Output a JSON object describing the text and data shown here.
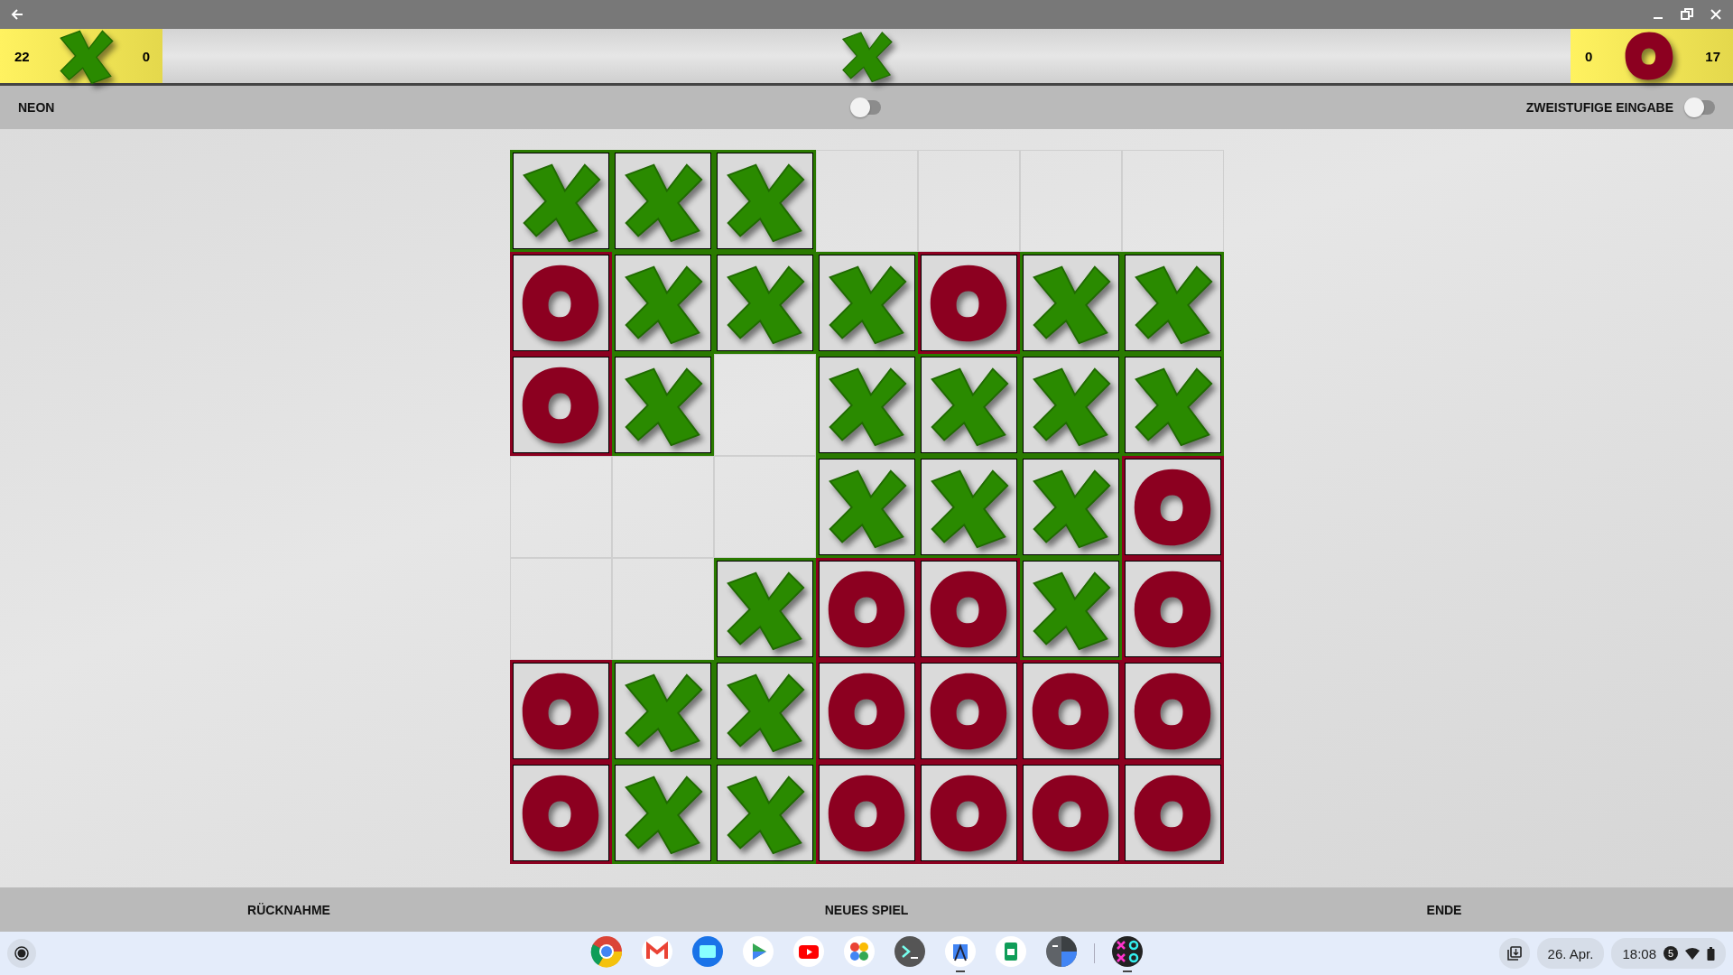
{
  "score": {
    "x_wins": "22",
    "x_losses": "0",
    "o_losses": "0",
    "o_wins": "17",
    "turn": {
      "kind": "x"
    }
  },
  "options": [
    {
      "label": "NEON",
      "on": false
    },
    {
      "label": "ZWEISTUFIGE EINGABE",
      "on": false
    }
  ],
  "board": {
    "rows": [
      [
        {
          "kind": "x"
        },
        {
          "kind": "x"
        },
        {
          "kind": "x"
        },
        {
          "kind": "empty"
        },
        {
          "kind": "empty"
        },
        {
          "kind": "empty"
        },
        {
          "kind": "empty"
        }
      ],
      [
        {
          "kind": "o"
        },
        {
          "kind": "x"
        },
        {
          "kind": "x"
        },
        {
          "kind": "x"
        },
        {
          "kind": "o"
        },
        {
          "kind": "x"
        },
        {
          "kind": "x"
        }
      ],
      [
        {
          "kind": "o"
        },
        {
          "kind": "x"
        },
        {
          "kind": "empty"
        },
        {
          "kind": "x"
        },
        {
          "kind": "x"
        },
        {
          "kind": "x"
        },
        {
          "kind": "x"
        }
      ],
      [
        {
          "kind": "empty"
        },
        {
          "kind": "empty"
        },
        {
          "kind": "empty"
        },
        {
          "kind": "x"
        },
        {
          "kind": "x"
        },
        {
          "kind": "x"
        },
        {
          "kind": "o"
        }
      ],
      [
        {
          "kind": "empty"
        },
        {
          "kind": "empty"
        },
        {
          "kind": "x"
        },
        {
          "kind": "o"
        },
        {
          "kind": "o"
        },
        {
          "kind": "x"
        },
        {
          "kind": "o"
        }
      ],
      [
        {
          "kind": "o"
        },
        {
          "kind": "x"
        },
        {
          "kind": "x"
        },
        {
          "kind": "o"
        },
        {
          "kind": "o"
        },
        {
          "kind": "o"
        },
        {
          "kind": "o"
        }
      ],
      [
        {
          "kind": "o"
        },
        {
          "kind": "x"
        },
        {
          "kind": "x"
        },
        {
          "kind": "o"
        },
        {
          "kind": "o"
        },
        {
          "kind": "o"
        },
        {
          "kind": "o"
        }
      ]
    ]
  },
  "buttons": [
    "RÜCKNAHME",
    "NEUES SPIEL",
    "ENDE"
  ],
  "shelf": [
    {
      "kind": "chrome",
      "running": false
    },
    {
      "kind": "gmail",
      "running": false
    },
    {
      "kind": "files",
      "running": false
    },
    {
      "kind": "play",
      "running": false
    },
    {
      "kind": "youtube",
      "running": false
    },
    {
      "kind": "photos",
      "running": false
    },
    {
      "kind": "terminal",
      "running": false
    },
    {
      "kind": "studio",
      "running": true
    },
    {
      "kind": "sheets",
      "running": false
    },
    {
      "kind": "calculator",
      "running": false
    },
    {
      "kind": "tictactoe",
      "running": true
    }
  ],
  "status": {
    "date": "26. Apr.",
    "time": "18:08",
    "notifications": "5"
  }
}
